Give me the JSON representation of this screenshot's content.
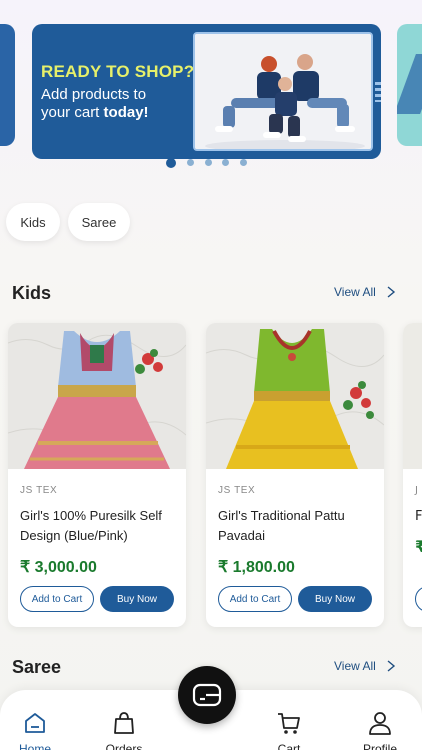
{
  "banner": {
    "headline": "READY TO SHOP?",
    "sub_line1": "Add products to",
    "sub_line2": "your cart",
    "sub_bold": "today!",
    "colors": {
      "background": "#1f5b99",
      "headline": "#e6f06a"
    }
  },
  "carousel": {
    "slides": 5,
    "active_index": 0
  },
  "categories": [
    {
      "label": "Kids"
    },
    {
      "label": "Saree"
    }
  ],
  "sections": {
    "kids": {
      "title": "Kids",
      "view_all": "View All"
    },
    "saree": {
      "title": "Saree",
      "view_all": "View All"
    }
  },
  "products": [
    {
      "brand": "JS TEX",
      "name": "Girl's 100% Puresilk Self Design (Blue/Pink)",
      "price": "₹ 3,000.00",
      "add_to_cart": "Add to Cart",
      "buy_now": "Buy Now"
    },
    {
      "brand": "JS TEX",
      "name": "Girl's Traditional Pattu Pavadai",
      "price": "₹ 1,800.00",
      "add_to_cart": "Add to Cart",
      "buy_now": "Buy Now"
    }
  ],
  "partial_product": {
    "brand": "J",
    "name": "F",
    "price": "₹"
  },
  "tabbar": {
    "home": "Home",
    "orders": "Orders",
    "cart": "Cart",
    "profile": "Profile",
    "active": "home"
  },
  "colors": {
    "accent": "#1f5b99",
    "price": "#1a7a2d",
    "fab": "#111111"
  },
  "icons": {
    "home": "home-icon",
    "orders": "shopping-bag-icon",
    "cart": "cart-icon",
    "profile": "user-icon",
    "fab": "wallet-icon",
    "view_all": "chevron-right-icon"
  }
}
